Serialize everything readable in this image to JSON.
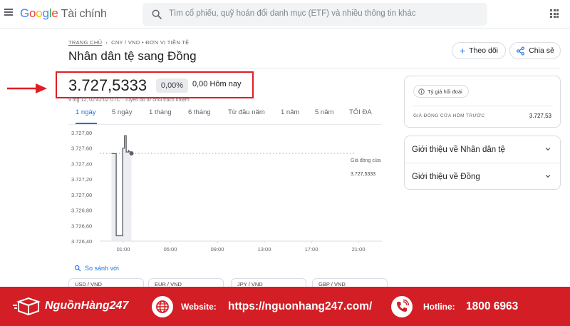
{
  "header": {
    "logo_google": "Google",
    "logo_suffix": "Tài chính",
    "search_placeholder": "Tìm cổ phiếu, quỹ hoán đổi danh mục (ETF) và nhiều thông tin khác"
  },
  "breadcrumb": {
    "home": "TRANG CHỦ",
    "current": "CNY / VND • ĐƠN VỊ TIỀN TỆ"
  },
  "page_title": "Nhân dân tệ sang Đồng",
  "actions": {
    "follow_label": "Theo dõi",
    "share_label": "Chia sẻ"
  },
  "quote": {
    "price": "3.727,5333",
    "change_pct": "0,00%",
    "change_abs": "0,00 Hôm nay",
    "timestamp": "9 thg 12, 02:42:02 UTC · Tuyên bố từ chối trách nhiệm"
  },
  "range_tabs": [
    "1 ngày",
    "5 ngày",
    "1 tháng",
    "6 tháng",
    "Từ đầu năm",
    "1 năm",
    "5 năm",
    "TỐI ĐA"
  ],
  "range_tabs_active": "1 ngày",
  "chart_data": {
    "type": "line",
    "x_ticks": [
      "01:00",
      "05:00",
      "09:00",
      "13:00",
      "17:00",
      "21:00"
    ],
    "y_ticks": [
      "3.727,80",
      "3.727,60",
      "3.727,40",
      "3.727,20",
      "3.727,00",
      "3.726,80",
      "3.726,60",
      "3.726,40"
    ],
    "ylim": [
      3726.4,
      3727.8
    ],
    "series": [
      {
        "x_hours": [
          0.0,
          0.4,
          0.4,
          0.95,
          0.95,
          1.1,
          1.1,
          1.25,
          1.25,
          1.45,
          1.45,
          1.7
        ],
        "values": [
          3727.53,
          3727.53,
          3726.47,
          3726.47,
          3727.6,
          3727.6,
          3727.76,
          3727.76,
          3727.55,
          3727.55,
          3727.57,
          3727.5333
        ]
      }
    ],
    "previous_close_label": "Giá đóng cửa",
    "previous_close_value": "3.727,5333",
    "previous_close": 3727.5333,
    "line_color": "#5f6368"
  },
  "compare": {
    "label": "So sánh với"
  },
  "compare_pairs": [
    "USD / VND",
    "EUR / VND",
    "JPY / VND",
    "GBP / VND"
  ],
  "info_card": {
    "chip_label": "Tỷ giá hối đoái",
    "prev_close_label": "GIÁ ĐÓNG CỬA HÔM TRƯỚC",
    "prev_close_value": "3.727,53"
  },
  "about": [
    "Giới thiệu về Nhân dân tệ",
    "Giới thiệu về Đồng"
  ],
  "banner": {
    "brand": "NguồnHàng247",
    "website_label": "Website:",
    "website_value": "https://nguonhang247.com/",
    "hotline_label": "Hotline:",
    "hotline_value": "1800 6963",
    "background_color": "#d31e25"
  }
}
